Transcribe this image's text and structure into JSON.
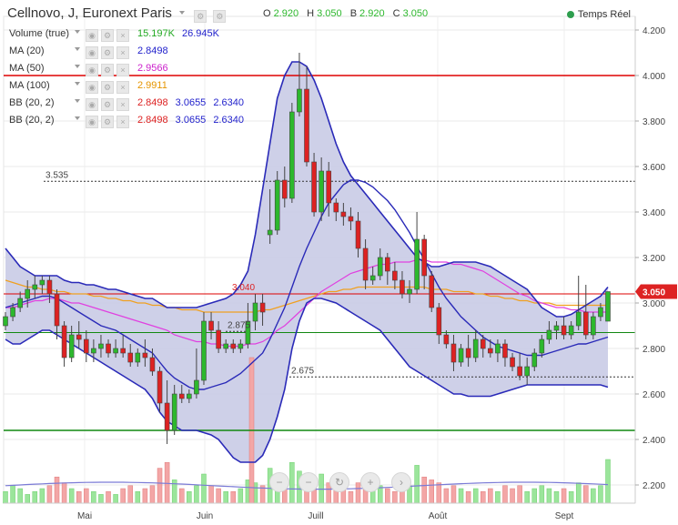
{
  "header": {
    "title": "Cellnovo, J, Euronext Paris",
    "ohlc": {
      "o_key": "O",
      "o": "2.920",
      "h_key": "H",
      "h": "3.050",
      "b_key": "B",
      "b": "2.920",
      "c_key": "C",
      "c": "3.050"
    },
    "live": "Temps Réel"
  },
  "indicators": [
    {
      "label": "Volume (true)",
      "values": [
        "15.197K",
        "26.945K"
      ],
      "colors": [
        "#22a922",
        "#2222cc"
      ]
    },
    {
      "label": "MA (20)",
      "values": [
        "2.8498"
      ],
      "colors": [
        "#2222cc"
      ]
    },
    {
      "label": "MA (50)",
      "values": [
        "2.9566"
      ],
      "colors": [
        "#cc22cc"
      ]
    },
    {
      "label": "MA (100)",
      "values": [
        "2.9911"
      ],
      "colors": [
        "#e69500"
      ]
    },
    {
      "label": "BB (20, 2)",
      "values": [
        "2.8498",
        "3.0655",
        "2.6340"
      ],
      "colors": [
        "#dd2222",
        "#2222cc",
        "#2222cc"
      ]
    },
    {
      "label": "BB (20, 2)",
      "values": [
        "2.8498",
        "3.0655",
        "2.6340"
      ],
      "colors": [
        "#dd2222",
        "#2222cc",
        "#2222cc"
      ]
    }
  ],
  "chart_data": {
    "type": "candlestick",
    "x_labels": [
      "Mai",
      "Juin",
      "Juill",
      "Août",
      "Sept"
    ],
    "y_ticks": [
      "2.200",
      "2.400",
      "2.600",
      "2.800",
      "3.000",
      "3.200",
      "3.400",
      "3.600",
      "3.800",
      "4.000",
      "4.200"
    ],
    "ylim": [
      2.12,
      4.26
    ],
    "last_price": "3.050",
    "level_labels": [
      {
        "text": "3.535",
        "price": 3.535
      },
      {
        "text": "3.040",
        "price": 3.04
      },
      {
        "text": "2.875",
        "price": 2.875
      },
      {
        "text": "2.675",
        "price": 2.675
      }
    ],
    "hlines": [
      {
        "price": 4.0,
        "color": "#dd0000"
      },
      {
        "price": 2.44,
        "color": "#118811"
      },
      {
        "price": 3.04,
        "color": "#dd0000"
      },
      {
        "price": 2.87,
        "color": "#118811"
      }
    ],
    "dotted_levels": [
      3.535,
      2.675
    ],
    "candles": [
      [
        2.9,
        2.96,
        2.88,
        2.94
      ],
      [
        2.94,
        3.0,
        2.92,
        2.98
      ],
      [
        2.98,
        3.05,
        2.96,
        3.02
      ],
      [
        3.02,
        3.1,
        2.98,
        3.06
      ],
      [
        3.06,
        3.12,
        3.02,
        3.08
      ],
      [
        3.08,
        3.12,
        3.04,
        3.1
      ],
      [
        3.1,
        3.12,
        3.0,
        3.04
      ],
      [
        3.04,
        3.06,
        2.84,
        2.9
      ],
      [
        2.9,
        2.92,
        2.72,
        2.76
      ],
      [
        2.76,
        2.9,
        2.74,
        2.86
      ],
      [
        2.86,
        2.92,
        2.8,
        2.84
      ],
      [
        2.84,
        2.88,
        2.74,
        2.78
      ],
      [
        2.78,
        2.84,
        2.74,
        2.8
      ],
      [
        2.8,
        2.86,
        2.76,
        2.82
      ],
      [
        2.82,
        2.84,
        2.76,
        2.78
      ],
      [
        2.78,
        2.84,
        2.76,
        2.8
      ],
      [
        2.8,
        2.86,
        2.76,
        2.78
      ],
      [
        2.78,
        2.82,
        2.72,
        2.74
      ],
      [
        2.74,
        2.8,
        2.72,
        2.78
      ],
      [
        2.78,
        2.84,
        2.72,
        2.76
      ],
      [
        2.76,
        2.8,
        2.68,
        2.7
      ],
      [
        2.7,
        2.72,
        2.52,
        2.56
      ],
      [
        2.56,
        2.66,
        2.38,
        2.44
      ],
      [
        2.44,
        2.64,
        2.42,
        2.6
      ],
      [
        2.6,
        2.64,
        2.56,
        2.58
      ],
      [
        2.58,
        2.62,
        2.56,
        2.6
      ],
      [
        2.6,
        2.8,
        2.58,
        2.66
      ],
      [
        2.66,
        2.96,
        2.64,
        2.92
      ],
      [
        2.92,
        2.96,
        2.84,
        2.88
      ],
      [
        2.88,
        2.92,
        2.78,
        2.8
      ],
      [
        2.8,
        2.84,
        2.78,
        2.82
      ],
      [
        2.82,
        2.84,
        2.78,
        2.8
      ],
      [
        2.8,
        2.84,
        2.78,
        2.82
      ],
      [
        2.82,
        3.0,
        2.8,
        2.92
      ],
      [
        2.92,
        3.04,
        2.88,
        3.0
      ],
      [
        3.0,
        3.04,
        2.9,
        2.96
      ],
      [
        3.3,
        3.5,
        3.26,
        3.32
      ],
      [
        3.32,
        3.58,
        3.3,
        3.54
      ],
      [
        3.54,
        3.6,
        3.42,
        3.46
      ],
      [
        3.46,
        3.88,
        3.44,
        3.84
      ],
      [
        3.84,
        4.1,
        3.82,
        3.94
      ],
      [
        3.94,
        4.04,
        3.6,
        3.62
      ],
      [
        3.62,
        3.66,
        3.38,
        3.4
      ],
      [
        3.4,
        3.64,
        3.36,
        3.58
      ],
      [
        3.58,
        3.62,
        3.38,
        3.44
      ],
      [
        3.44,
        3.46,
        3.36,
        3.4
      ],
      [
        3.4,
        3.44,
        3.34,
        3.38
      ],
      [
        3.38,
        3.42,
        3.32,
        3.36
      ],
      [
        3.36,
        3.4,
        3.2,
        3.24
      ],
      [
        3.24,
        3.28,
        3.06,
        3.1
      ],
      [
        3.1,
        3.16,
        3.08,
        3.12
      ],
      [
        3.12,
        3.24,
        3.1,
        3.2
      ],
      [
        3.2,
        3.22,
        3.08,
        3.14
      ],
      [
        3.14,
        3.18,
        3.06,
        3.1
      ],
      [
        3.1,
        3.14,
        3.02,
        3.04
      ],
      [
        3.04,
        3.1,
        3.0,
        3.06
      ],
      [
        3.06,
        3.4,
        3.04,
        3.28
      ],
      [
        3.28,
        3.3,
        3.06,
        3.12
      ],
      [
        3.12,
        3.14,
        2.96,
        2.98
      ],
      [
        2.98,
        3.0,
        2.82,
        2.86
      ],
      [
        2.86,
        2.88,
        2.8,
        2.82
      ],
      [
        2.82,
        2.86,
        2.7,
        2.74
      ],
      [
        2.74,
        2.82,
        2.72,
        2.8
      ],
      [
        2.8,
        2.86,
        2.72,
        2.76
      ],
      [
        2.76,
        2.88,
        2.74,
        2.84
      ],
      [
        2.84,
        2.86,
        2.76,
        2.8
      ],
      [
        2.8,
        2.84,
        2.76,
        2.78
      ],
      [
        2.78,
        2.84,
        2.74,
        2.82
      ],
      [
        2.82,
        2.84,
        2.72,
        2.76
      ],
      [
        2.76,
        2.78,
        2.7,
        2.72
      ],
      [
        2.72,
        2.78,
        2.66,
        2.68
      ],
      [
        2.68,
        2.76,
        2.64,
        2.72
      ],
      [
        2.72,
        2.8,
        2.7,
        2.78
      ],
      [
        2.78,
        2.86,
        2.76,
        2.84
      ],
      [
        2.84,
        2.92,
        2.82,
        2.88
      ],
      [
        2.88,
        2.92,
        2.84,
        2.9
      ],
      [
        2.9,
        2.94,
        2.84,
        2.86
      ],
      [
        2.86,
        2.92,
        2.84,
        2.9
      ],
      [
        2.9,
        3.12,
        2.88,
        2.96
      ],
      [
        2.96,
        3.08,
        2.84,
        2.86
      ],
      [
        2.86,
        2.96,
        2.84,
        2.94
      ],
      [
        2.94,
        3.0,
        2.92,
        2.98
      ],
      [
        2.92,
        3.05,
        2.92,
        3.05
      ]
    ],
    "volumes": [
      4,
      6,
      5,
      3,
      4,
      5,
      6,
      9,
      7,
      5,
      4,
      5,
      4,
      3,
      4,
      3,
      5,
      6,
      4,
      5,
      6,
      12,
      14,
      8,
      5,
      4,
      6,
      10,
      6,
      5,
      4,
      4,
      5,
      8,
      7,
      6,
      12,
      10,
      8,
      14,
      11,
      9,
      8,
      10,
      7,
      5,
      6,
      4,
      7,
      9,
      5,
      6,
      5,
      4,
      5,
      6,
      13,
      9,
      8,
      7,
      5,
      6,
      5,
      4,
      5,
      4,
      5,
      4,
      6,
      5,
      6,
      4,
      5,
      6,
      5,
      4,
      5,
      4,
      7,
      6,
      5,
      6,
      15
    ],
    "ma20": [
      2.98,
      2.99,
      3.0,
      3.01,
      3.02,
      3.03,
      3.03,
      3.02,
      3.0,
      2.98,
      2.96,
      2.94,
      2.92,
      2.9,
      2.89,
      2.88,
      2.86,
      2.84,
      2.82,
      2.8,
      2.78,
      2.74,
      2.7,
      2.67,
      2.65,
      2.63,
      2.62,
      2.62,
      2.63,
      2.64,
      2.65,
      2.67,
      2.69,
      2.72,
      2.75,
      2.78,
      2.84,
      2.91,
      2.98,
      3.07,
      3.16,
      3.24,
      3.31,
      3.38,
      3.44,
      3.48,
      3.52,
      3.54,
      3.54,
      3.53,
      3.51,
      3.48,
      3.45,
      3.41,
      3.36,
      3.31,
      3.25,
      3.19,
      3.13,
      3.07,
      3.02,
      2.98,
      2.94,
      2.91,
      2.88,
      2.85,
      2.83,
      2.81,
      2.8,
      2.79,
      2.78,
      2.77,
      2.77,
      2.77,
      2.78,
      2.79,
      2.8,
      2.81,
      2.82,
      2.82,
      2.83,
      2.84,
      2.85
    ],
    "ma50": [
      2.98,
      2.98,
      2.99,
      3.0,
      3.01,
      3.01,
      3.02,
      3.02,
      3.01,
      3.0,
      3.0,
      2.99,
      2.98,
      2.97,
      2.96,
      2.95,
      2.94,
      2.93,
      2.92,
      2.91,
      2.9,
      2.89,
      2.88,
      2.86,
      2.85,
      2.84,
      2.83,
      2.83,
      2.82,
      2.82,
      2.81,
      2.81,
      2.81,
      2.82,
      2.82,
      2.83,
      2.85,
      2.88,
      2.9,
      2.93,
      2.96,
      2.99,
      3.02,
      3.05,
      3.07,
      3.09,
      3.11,
      3.13,
      3.14,
      3.15,
      3.16,
      3.17,
      3.17,
      3.18,
      3.18,
      3.18,
      3.19,
      3.19,
      3.18,
      3.18,
      3.18,
      3.17,
      3.17,
      3.16,
      3.15,
      3.14,
      3.12,
      3.1,
      3.08,
      3.06,
      3.04,
      3.03,
      3.01,
      3.0,
      2.99,
      2.98,
      2.98,
      2.97,
      2.97,
      2.96,
      2.96,
      2.96,
      2.96
    ],
    "ma100": [
      3.1,
      3.09,
      3.08,
      3.07,
      3.07,
      3.06,
      3.06,
      3.05,
      3.05,
      3.04,
      3.04,
      3.04,
      3.03,
      3.03,
      3.02,
      3.02,
      3.01,
      3.01,
      3.0,
      3.0,
      2.99,
      2.99,
      2.98,
      2.98,
      2.97,
      2.97,
      2.97,
      2.96,
      2.96,
      2.96,
      2.96,
      2.96,
      2.96,
      2.96,
      2.96,
      2.97,
      2.97,
      2.98,
      2.99,
      3.0,
      3.01,
      3.02,
      3.03,
      3.04,
      3.05,
      3.05,
      3.06,
      3.06,
      3.07,
      3.07,
      3.07,
      3.07,
      3.07,
      3.07,
      3.07,
      3.07,
      3.07,
      3.07,
      3.06,
      3.06,
      3.06,
      3.05,
      3.05,
      3.05,
      3.04,
      3.04,
      3.03,
      3.03,
      3.02,
      3.02,
      3.01,
      3.01,
      3.0,
      3.0,
      3.0,
      2.99,
      2.99,
      2.99,
      2.99,
      2.99,
      2.99,
      2.99,
      2.99
    ],
    "bb_upper": [
      3.24,
      3.2,
      3.16,
      3.14,
      3.12,
      3.12,
      3.12,
      3.12,
      3.1,
      3.09,
      3.09,
      3.08,
      3.08,
      3.07,
      3.06,
      3.06,
      3.05,
      3.04,
      3.03,
      3.02,
      3.02,
      3.0,
      2.98,
      2.98,
      2.98,
      2.98,
      2.98,
      2.99,
      3.0,
      3.01,
      3.02,
      3.04,
      3.08,
      3.14,
      3.3,
      3.5,
      3.7,
      3.9,
      4.0,
      4.06,
      4.06,
      4.04,
      3.98,
      3.9,
      3.8,
      3.7,
      3.62,
      3.56,
      3.52,
      3.48,
      3.44,
      3.4,
      3.36,
      3.32,
      3.28,
      3.24,
      3.2,
      3.18,
      3.16,
      3.16,
      3.17,
      3.18,
      3.18,
      3.18,
      3.18,
      3.17,
      3.16,
      3.14,
      3.12,
      3.1,
      3.08,
      3.06,
      3.02,
      2.98,
      2.96,
      2.94,
      2.94,
      2.95,
      2.97,
      2.99,
      3.01,
      3.03,
      3.07
    ],
    "bb_lower": [
      2.84,
      2.82,
      2.82,
      2.84,
      2.86,
      2.88,
      2.88,
      2.86,
      2.84,
      2.82,
      2.8,
      2.78,
      2.76,
      2.74,
      2.72,
      2.7,
      2.68,
      2.66,
      2.64,
      2.62,
      2.58,
      2.52,
      2.48,
      2.46,
      2.44,
      2.44,
      2.44,
      2.43,
      2.42,
      2.4,
      2.36,
      2.32,
      2.3,
      2.3,
      2.3,
      2.33,
      2.4,
      2.5,
      2.62,
      2.8,
      2.92,
      3.0,
      3.02,
      3.02,
      3.01,
      3.0,
      2.98,
      2.96,
      2.94,
      2.92,
      2.9,
      2.88,
      2.84,
      2.8,
      2.76,
      2.72,
      2.7,
      2.68,
      2.66,
      2.64,
      2.62,
      2.6,
      2.6,
      2.59,
      2.59,
      2.59,
      2.59,
      2.6,
      2.61,
      2.62,
      2.63,
      2.64,
      2.64,
      2.64,
      2.64,
      2.64,
      2.64,
      2.64,
      2.64,
      2.64,
      2.64,
      2.64,
      2.63
    ]
  }
}
